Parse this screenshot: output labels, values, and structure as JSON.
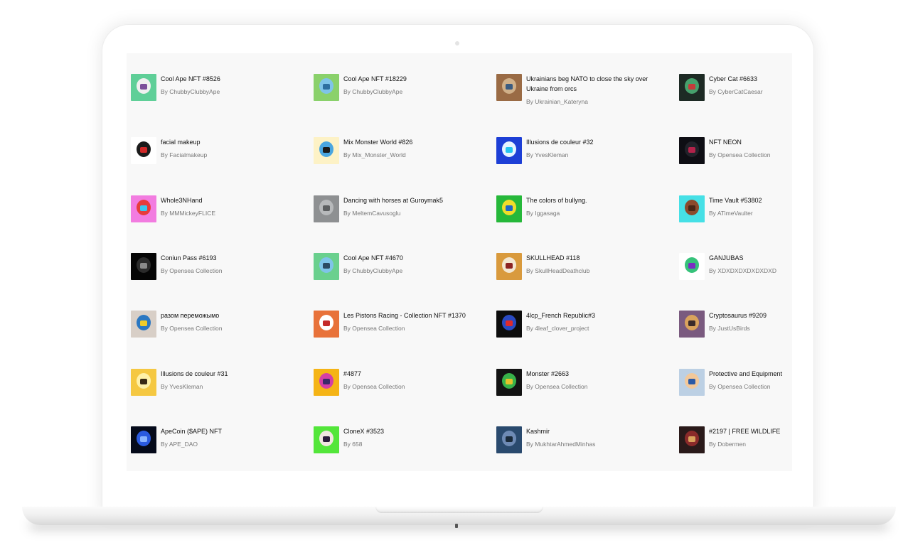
{
  "by_label": "By",
  "items": [
    {
      "title": "Cool Ape NFT #8526",
      "artist": "ChubbyClubbyApe",
      "bg": "#5fcf98",
      "c1": "#f0f0f0",
      "c2": "#7b4f9a"
    },
    {
      "title": "Cool Ape NFT #18229",
      "artist": "ChubbyClubbyApe",
      "bg": "#8ad16b",
      "c1": "#7fc4e9",
      "c2": "#2d6fa0"
    },
    {
      "title": "Ukrainians beg NATO to close the sky over Ukraine from orcs",
      "artist": "Ukrainian_Kateryna",
      "bg": "#9a6b45",
      "c1": "#d0b089",
      "c2": "#3a5b80"
    },
    {
      "title": "Cyber Cat #6633",
      "artist": "CyberCatCaesar",
      "bg": "#1d2a24",
      "c1": "#46a06c",
      "c2": "#c63b3b"
    },
    {
      "title": "facial makeup",
      "artist": "Facialmakeup",
      "bg": "#ffffff",
      "c1": "#1b1b1b",
      "c2": "#d12828"
    },
    {
      "title": "Mix Monster World #826",
      "artist": "Mix_Monster_World",
      "bg": "#fdf2c6",
      "c1": "#4aa6e0",
      "c2": "#1a1a1a"
    },
    {
      "title": "Illusions de couleur #32",
      "artist": "YvesKleman",
      "bg": "#1d3fd6",
      "c1": "#e6f4ff",
      "c2": "#25c4f0"
    },
    {
      "title": "NFT NEON",
      "artist": "Opensea Collection",
      "bg": "#0e0e14",
      "c1": "#22222a",
      "c2": "#b3224a"
    },
    {
      "title": "Whole3NHand",
      "artist": "MMMickeyFLICE",
      "bg": "#f27ce0",
      "c1": "#e73c3c",
      "c2": "#3cc8f0"
    },
    {
      "title": "Dancing with horses at Guroymak5",
      "artist": "MeltemCavusoglu",
      "bg": "#8e9092",
      "c1": "#b7b9bb",
      "c2": "#5d5f61"
    },
    {
      "title": "The colors of bullyng.",
      "artist": "Iggasaga",
      "bg": "#26b83a",
      "c1": "#f0dd2a",
      "c2": "#1d67c7"
    },
    {
      "title": "Time Vault #53802",
      "artist": "ATimeVaulter",
      "bg": "#46e0e6",
      "c1": "#8b4a2d",
      "c2": "#4a2616"
    },
    {
      "title": "Coniun Pass #6193",
      "artist": "Opensea Collection",
      "bg": "#050505",
      "c1": "#2b2b2b",
      "c2": "#8a8a8a"
    },
    {
      "title": "Cool Ape NFT #4670",
      "artist": "ChubbyClubbyApe",
      "bg": "#6ad08e",
      "c1": "#7fc4e9",
      "c2": "#2b4a63"
    },
    {
      "title": "SKULLHEAD #118",
      "artist": "SkullHeadDeathclub",
      "bg": "#d99a3d",
      "c1": "#f3e7d2",
      "c2": "#8c2323"
    },
    {
      "title": "GANJUBAS",
      "artist": "XDXDXDXDXDXDXD",
      "bg": "#ffffff",
      "c1": "#36c27a",
      "c2": "#7a2ec2"
    },
    {
      "title": "разом переможымо",
      "artist": "Opensea Collection",
      "bg": "#d8cfc7",
      "c1": "#2b78c2",
      "c2": "#f0cc2a"
    },
    {
      "title": "Les Pistons Racing - Collection NFT #1370",
      "artist": "Opensea Collection",
      "bg": "#e8723a",
      "c1": "#ffffff",
      "c2": "#c42a2a"
    },
    {
      "title": "4lcp_French Republic#3",
      "artist": "4leaf_clover_project",
      "bg": "#0d0d0d",
      "c1": "#2a4ac2",
      "c2": "#e02a2a"
    },
    {
      "title": "Cryptosaurus #9209",
      "artist": "JustUsBirds",
      "bg": "#7a5a7f",
      "c1": "#d9a25c",
      "c2": "#3a2a2a"
    },
    {
      "title": "Illusions de couleur #31",
      "artist": "YvesKleman",
      "bg": "#f5c842",
      "c1": "#fff1a8",
      "c2": "#3a2a14"
    },
    {
      "title": "#4877",
      "artist": "Opensea Collection",
      "bg": "#f5b416",
      "c1": "#d43fa6",
      "c2": "#3a2a6a"
    },
    {
      "title": "Monster #2663",
      "artist": "Opensea Collection",
      "bg": "#131313",
      "c1": "#38b24a",
      "c2": "#e6c12a"
    },
    {
      "title": "Protective and Equipment",
      "artist": "Opensea Collection",
      "bg": "#bcd0e4",
      "c1": "#f2c89a",
      "c2": "#2b5aa6"
    },
    {
      "title": "ApeCoin ($APE) NFT",
      "artist": "APE_DAO",
      "bg": "#050a1a",
      "c1": "#2a5ae0",
      "c2": "#8ab4ff"
    },
    {
      "title": "CloneX #3523",
      "artist": "658",
      "bg": "#53e63a",
      "c1": "#f0e6e0",
      "c2": "#2a1a3a"
    },
    {
      "title": "Kashmir",
      "artist": "MukhtarAhmedMinhas",
      "bg": "#2a4a6e",
      "c1": "#6e8ab4",
      "c2": "#1a2a3a"
    },
    {
      "title": "#2197 | FREE WILDLIFE",
      "artist": "Dobermen",
      "bg": "#2a1a1a",
      "c1": "#8a2a2a",
      "c2": "#d9a25c"
    }
  ]
}
